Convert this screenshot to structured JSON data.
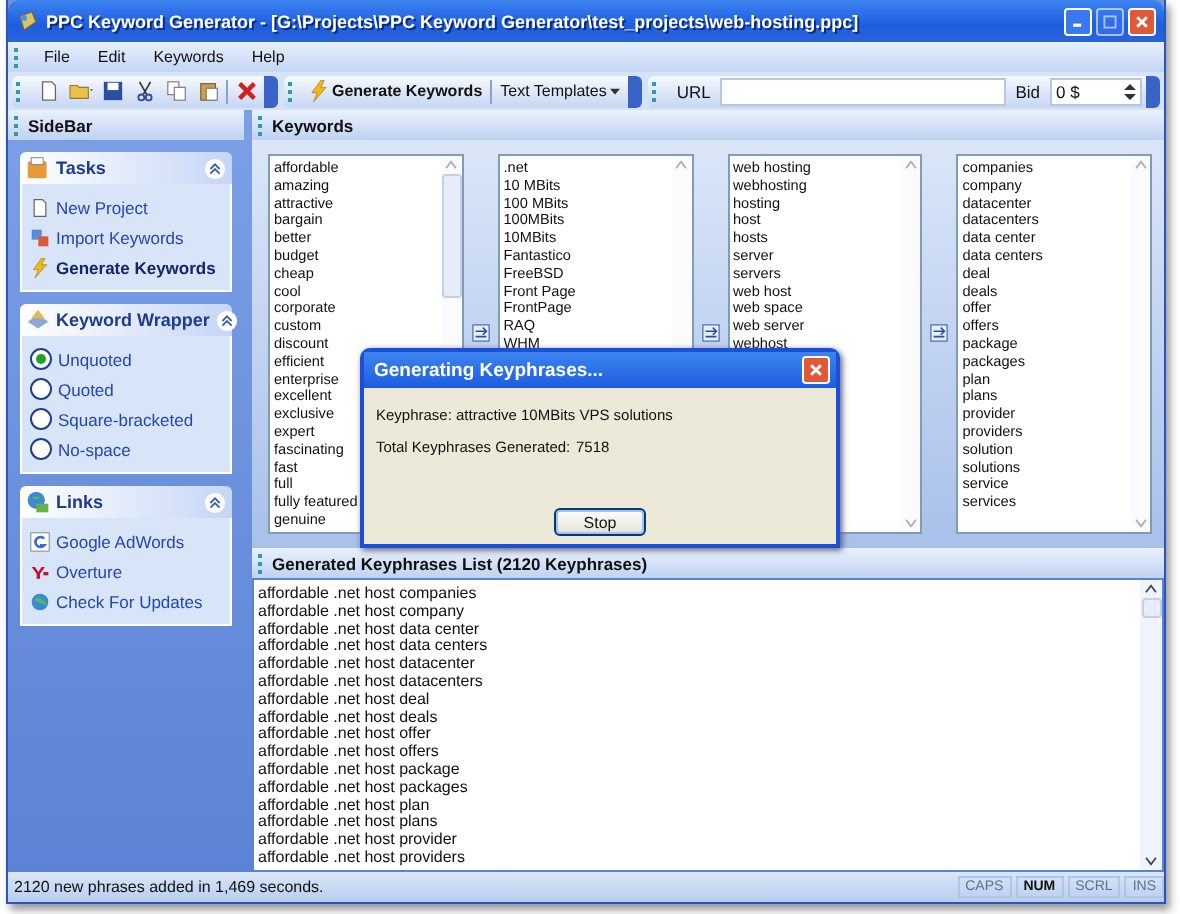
{
  "window": {
    "title": "PPC Keyword Generator - [G:\\Projects\\PPC Keyword Generator\\test_projects\\web-hosting.ppc]"
  },
  "menu": [
    "File",
    "Edit",
    "Keywords",
    "Help"
  ],
  "toolbar": {
    "generate_button": "Generate Keywords",
    "templates_button": "Text Templates",
    "url_label": "URL",
    "bid_label": "Bid",
    "bid_value": "0 $"
  },
  "sidebar": {
    "title": "SideBar",
    "panels": [
      {
        "title": "Tasks",
        "kind": "tasks",
        "items": [
          {
            "label": "New Project",
            "selected": false
          },
          {
            "label": "Import Keywords",
            "selected": false
          },
          {
            "label": "Generate Keywords",
            "selected": true
          }
        ]
      },
      {
        "title": "Keyword Wrapper",
        "kind": "options",
        "items": [
          {
            "label": "Unquoted",
            "selected": true
          },
          {
            "label": "Quoted",
            "selected": false
          },
          {
            "label": "Square-bracketed",
            "selected": false
          },
          {
            "label": "No-space",
            "selected": false
          }
        ]
      },
      {
        "title": "Links",
        "kind": "links",
        "items": [
          {
            "label": "Google AdWords"
          },
          {
            "label": "Overture"
          },
          {
            "label": "Check For Updates"
          }
        ]
      }
    ]
  },
  "keywords": {
    "title": "Keywords",
    "columns": [
      [
        "affordable",
        "amazing",
        "attractive",
        "bargain",
        "better",
        "budget",
        "cheap",
        "cool",
        "corporate",
        "custom",
        "discount",
        "efficient",
        "enterprise",
        "excellent",
        "exclusive",
        "expert",
        "fascinating",
        "fast",
        "full",
        "fully featured",
        "genuine"
      ],
      [
        ".net",
        "10 MBits",
        "100 MBits",
        "100MBits",
        "10MBits",
        "Fantastico",
        "FreeBSD",
        "Front Page",
        "FrontPage",
        "RAQ",
        "WHM"
      ],
      [
        "web hosting",
        "webhosting",
        "hosting",
        "host",
        "hosts",
        "server",
        "servers",
        "web host",
        "web space",
        "web server",
        "webhost"
      ],
      [
        "companies",
        "company",
        "datacenter",
        "datacenters",
        "data center",
        "data centers",
        "deal",
        "deals",
        "offer",
        "offers",
        "package",
        "packages",
        "plan",
        "plans",
        "provider",
        "providers",
        "solution",
        "solutions",
        "service",
        "services"
      ]
    ]
  },
  "generated": {
    "title": "Generated Keyphrases List (2120 Keyphrases)",
    "rows": [
      "affordable .net host companies",
      "affordable .net host company",
      "affordable .net host data center",
      "affordable .net host data centers",
      "affordable .net host datacenter",
      "affordable .net host datacenters",
      "affordable .net host deal",
      "affordable .net host deals",
      "affordable .net host offer",
      "affordable .net host offers",
      "affordable .net host package",
      "affordable .net host packages",
      "affordable .net host plan",
      "affordable .net host plans",
      "affordable .net host provider",
      "affordable .net host providers"
    ]
  },
  "dialog": {
    "title": "Generating Keyphrases...",
    "keyphrase_label": "Keyphrase:",
    "keyphrase": "attractive 10MBits VPS solutions",
    "total_label": "Total Keyphrases Generated:",
    "total": "7518",
    "button": "Stop"
  },
  "status_bar": {
    "message": "2120 new phrases added in 1,469 seconds.",
    "indicators": [
      {
        "label": "CAPS",
        "on": false
      },
      {
        "label": "NUM",
        "on": true
      },
      {
        "label": "SCRL",
        "on": false
      },
      {
        "label": "INS",
        "on": false
      }
    ]
  }
}
